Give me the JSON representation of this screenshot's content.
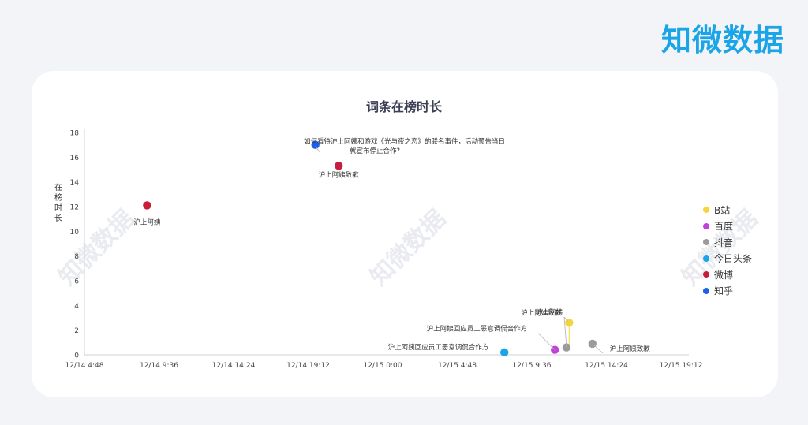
{
  "brand": "知微数据",
  "watermark": "知微数据",
  "chart_data": {
    "type": "scatter",
    "title": "词条在榜时长",
    "ylabel": "在榜时长",
    "xlabel": "",
    "x_ticks": [
      "12/14 4:48",
      "12/14 9:36",
      "12/14 14:24",
      "12/14 19:12",
      "12/15 0:00",
      "12/15 4:48",
      "12/15 9:36",
      "12/15 14:24",
      "12/15 19:12"
    ],
    "y_ticks": [
      "0",
      "2",
      "4",
      "6",
      "8",
      "10",
      "12",
      "14",
      "16",
      "18"
    ],
    "ylim": [
      0,
      18
    ],
    "legend_position": "right",
    "series": [
      {
        "name": "B站",
        "color": "#f5d63a",
        "points": [
          {
            "x": "12/15 12:00",
            "y": 2.6,
            "label": "沪上阿姨致歉"
          }
        ]
      },
      {
        "name": "百度",
        "color": "#c142d8",
        "points": [
          {
            "x": "12/15 11:05",
            "y": 0.4,
            "label": "沪上阿姨回应员工恶意调侃合作方"
          }
        ]
      },
      {
        "name": "抖音",
        "color": "#9a9a9a",
        "points": [
          {
            "x": "12/15 11:50",
            "y": 0.6,
            "label": "沪上阿姨"
          },
          {
            "x": "12/15 13:30",
            "y": 0.9,
            "label": "沪上阿姨致歉"
          }
        ]
      },
      {
        "name": "今日头条",
        "color": "#1aa5e8",
        "points": [
          {
            "x": "12/15 7:50",
            "y": 0.2,
            "label": "沪上阿姨回应员工恶意调侃合作方"
          }
        ]
      },
      {
        "name": "微博",
        "color": "#c81e3c",
        "points": [
          {
            "x": "12/14 8:50",
            "y": 12.1,
            "label": "沪上阿姨"
          },
          {
            "x": "12/14 21:10",
            "y": 15.3,
            "label": "沪上阿姨致歉"
          }
        ]
      },
      {
        "name": "知乎",
        "color": "#1e5ee8",
        "points": [
          {
            "x": "12/14 19:40",
            "y": 17.0,
            "label": "如何看待沪上阿姨和游戏《光与夜之恋》的联名事件，活动预告当日就宣布停止合作?"
          }
        ]
      }
    ]
  }
}
